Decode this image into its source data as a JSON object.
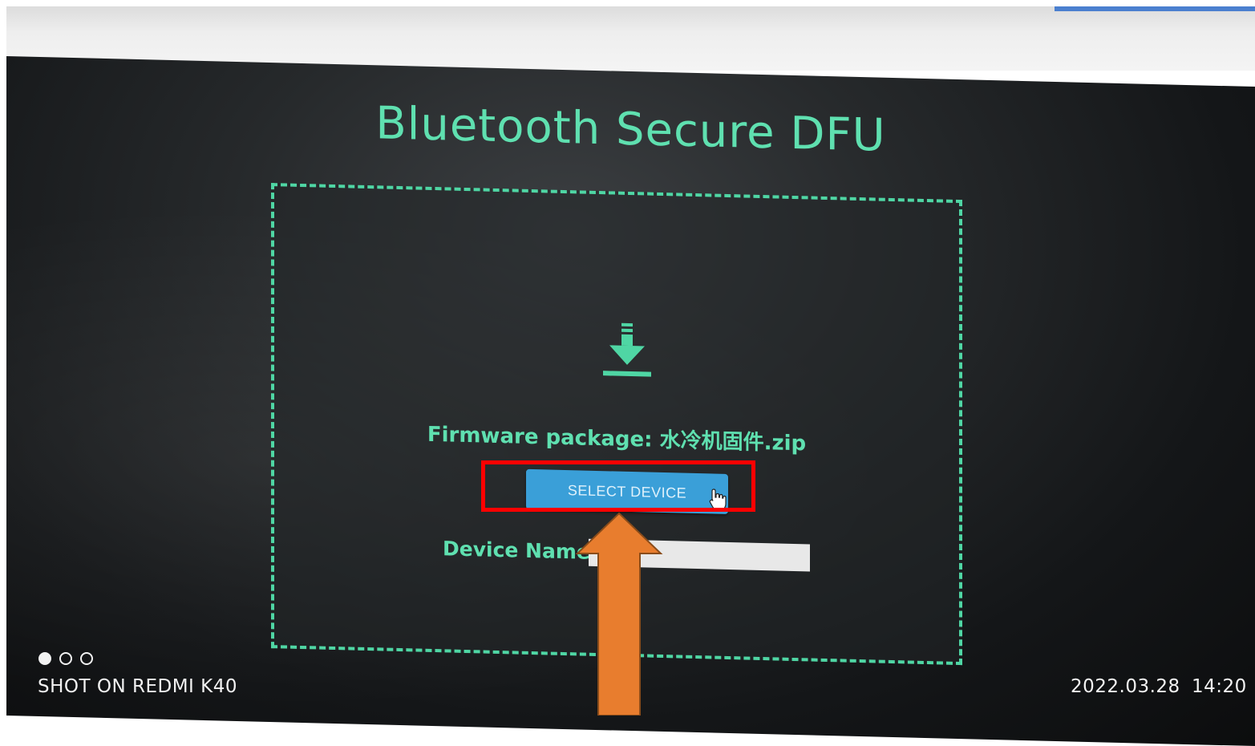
{
  "app": {
    "title": "Bluetooth Secure DFU"
  },
  "dropzone": {
    "icon": "download-icon",
    "firmware_text": "Firmware package: 水冷机固件.zip",
    "select_button_label": "SELECT DEVICE",
    "device_name_label": "Device Name :",
    "device_name_value": ""
  },
  "annotations": {
    "highlight_color": "#ff0000",
    "arrow_color": "#e87d2e"
  },
  "photo_overlay": {
    "shot_on": "SHOT ON REDMI K40",
    "date": "2022.03.28",
    "time": "14:20"
  },
  "colors": {
    "accent": "#5fe0b0",
    "button": "#3a9fd8"
  }
}
